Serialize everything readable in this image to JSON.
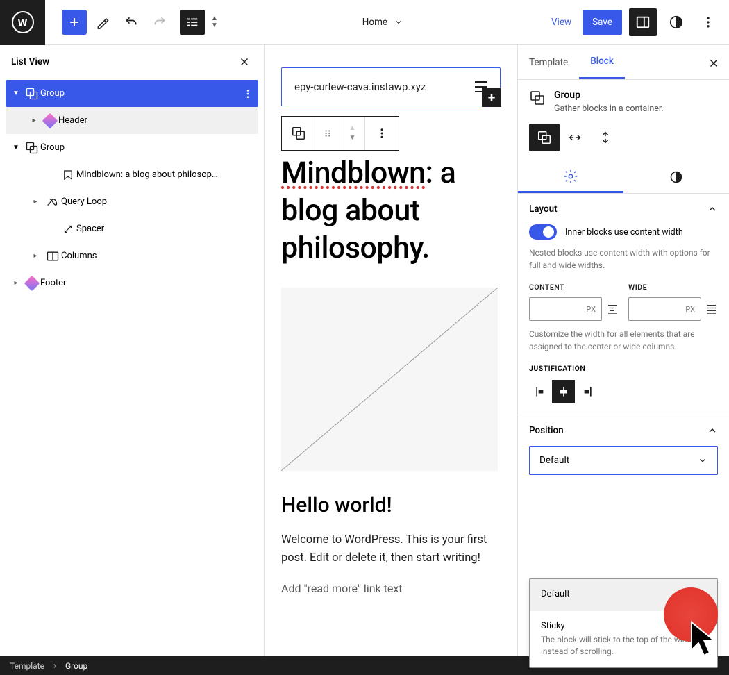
{
  "toolbar": {
    "page_label": "Home",
    "view": "View",
    "save": "Save"
  },
  "list_view": {
    "title": "List View",
    "items": [
      {
        "label": "Group",
        "icon": "group",
        "indent": 0,
        "expanded": true,
        "selected": true
      },
      {
        "label": "Header",
        "icon": "diamond",
        "indent": 1,
        "expandable": true
      },
      {
        "label": "Group",
        "icon": "group",
        "indent": 0,
        "expanded": true
      },
      {
        "label": "Mindblown: a blog about philosop…",
        "icon": "heading",
        "indent": 2
      },
      {
        "label": "Query Loop",
        "icon": "loop",
        "indent": 2,
        "expandable": true
      },
      {
        "label": "Spacer",
        "icon": "spacer",
        "indent": 2
      },
      {
        "label": "Columns",
        "icon": "columns",
        "indent": 2,
        "expandable": true
      },
      {
        "label": "Footer",
        "icon": "diamond",
        "indent": 0,
        "expandable": true
      }
    ]
  },
  "canvas": {
    "url": "epy-curlew-cava.instawp.xyz",
    "heading_mind": "Mindblown",
    "heading_rest": ": a blog about philosophy.",
    "post_title": "Hello world!",
    "post_body": "Welcome to WordPress. This is your first post. Edit or delete it, then start writing!",
    "read_more": "Add \"read more\" link text"
  },
  "inspector": {
    "tabs": {
      "template": "Template",
      "block": "Block"
    },
    "block_title": "Group",
    "block_desc": "Gather blocks in a container.",
    "layout": {
      "title": "Layout",
      "toggle_label": "Inner blocks use content width",
      "toggle_help": "Nested blocks use content width with options for full and wide widths.",
      "content_label": "CONTENT",
      "wide_label": "WIDE",
      "unit": "PX",
      "width_help": "Customize the width for all elements that are assigned to the center or wide columns.",
      "justification_label": "JUSTIFICATION"
    },
    "position": {
      "title": "Position",
      "selected": "Default",
      "options": [
        {
          "label": "Default",
          "selected": true
        },
        {
          "label": "Sticky",
          "desc": "The block will stick to the top of the window instead of scrolling."
        }
      ]
    }
  },
  "breadcrumb": {
    "template": "Template",
    "group": "Group"
  }
}
